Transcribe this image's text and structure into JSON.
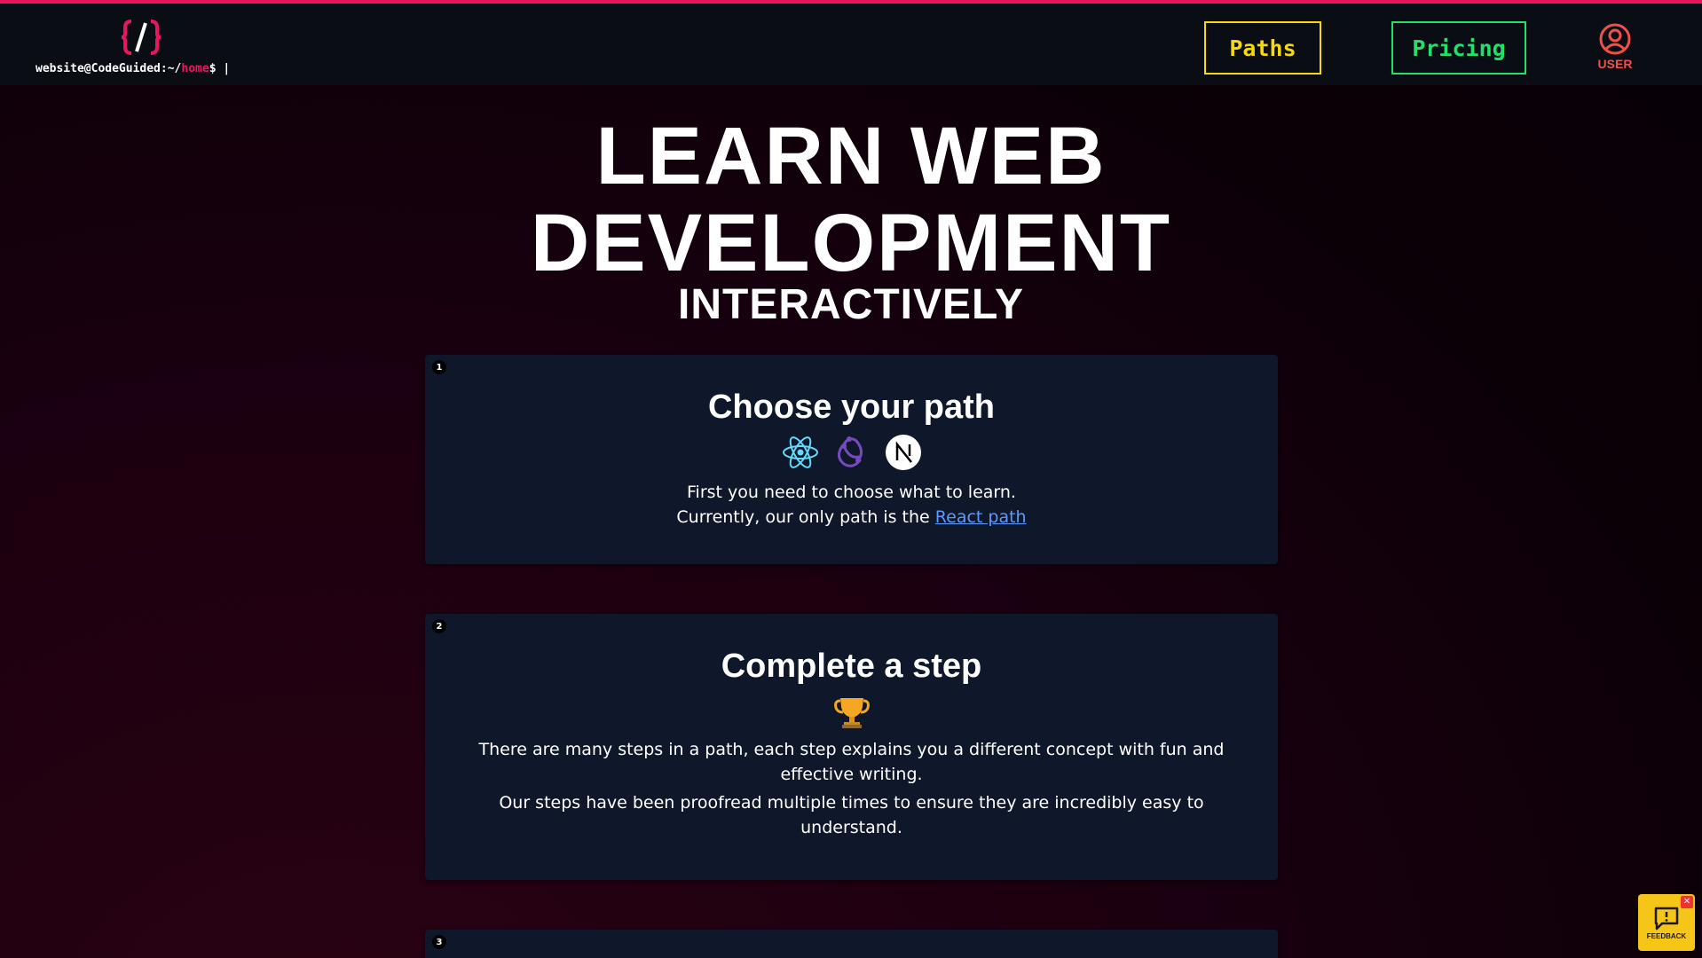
{
  "header": {
    "prompt_user": "website@CodeGuided:~/",
    "prompt_dir": "home",
    "prompt_suffix": "$ |",
    "paths_label": "Paths",
    "pricing_label": "Pricing",
    "user_label": "USER"
  },
  "hero": {
    "line1": "LEARN WEB",
    "line2": "DEVELOPMENT",
    "line3": "INTERACTIVELY"
  },
  "steps": [
    {
      "number": "1",
      "title": "Choose your path",
      "text_line1": "First you need to choose what to learn.",
      "text_line2": "Currently, our only path is the ",
      "link": "React path",
      "icons": [
        "react-icon",
        "redux-icon",
        "nextjs-icon"
      ]
    },
    {
      "number": "2",
      "title": "Complete a step",
      "text_line1": "There are many steps in a path, each step explains you a different concept with fun and effective writing.",
      "text_line2": "Our steps have been proofread multiple times to ensure they are incredibly easy to understand.",
      "icons": [
        "trophy-icon"
      ]
    },
    {
      "number": "3"
    }
  ],
  "feedback": {
    "label": "FEEDBACK",
    "close": "✕"
  },
  "colors": {
    "accent": "#e8175d",
    "paths": "#f5d90a",
    "pricing": "#22e06a",
    "user": "#f0504a",
    "card": "#0f172a",
    "link": "#5b9bff",
    "feedback": "#f5c518"
  }
}
